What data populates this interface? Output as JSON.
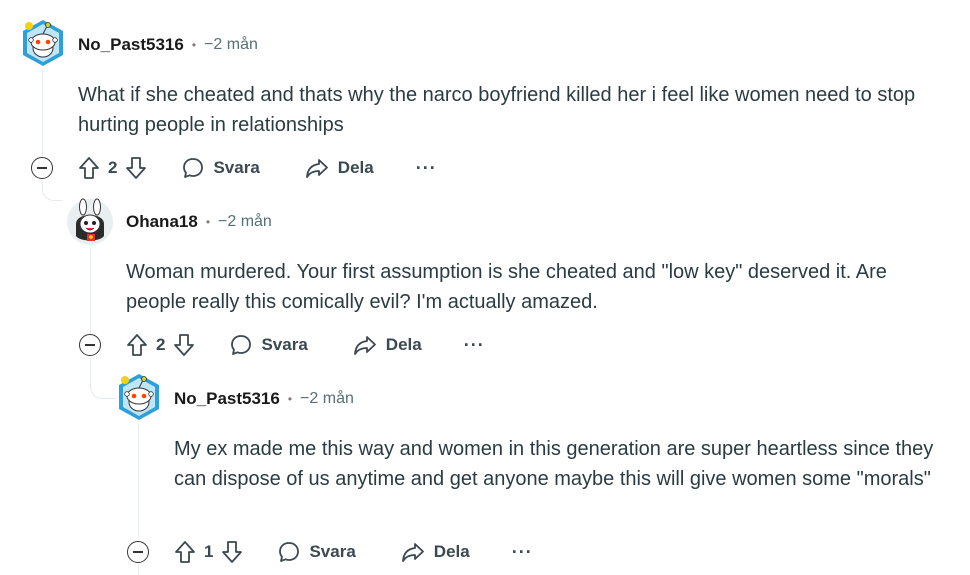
{
  "comments": [
    {
      "username": "No_Past5316",
      "time": "−2 mån",
      "body": "What if she cheated and thats why the narco boyfriend killed her i feel like women need to stop hurting people in relationships",
      "votes": "2",
      "reply_label": "Svara",
      "share_label": "Dela",
      "avatar_icon": "snoo-avatar-icon"
    },
    {
      "username": "Ohana18",
      "time": "−2 mån",
      "body": "Woman murdered. Your first assumption is she cheated and \"low key\" deserved it. Are people really this comically evil? I'm actually amazed.",
      "votes": "2",
      "reply_label": "Svara",
      "share_label": "Dela",
      "avatar_icon": "bunny-avatar-icon"
    },
    {
      "username": "No_Past5316",
      "time": "−2 mån",
      "body": "My ex made me this way and women in this generation are super heartless since they can dispose of us anytime and get anyone maybe this will give women some \"morals\"",
      "votes": "1",
      "reply_label": "Svara",
      "share_label": "Dela",
      "avatar_icon": "snoo-avatar-icon"
    }
  ],
  "more_label": "···",
  "separator": "•"
}
